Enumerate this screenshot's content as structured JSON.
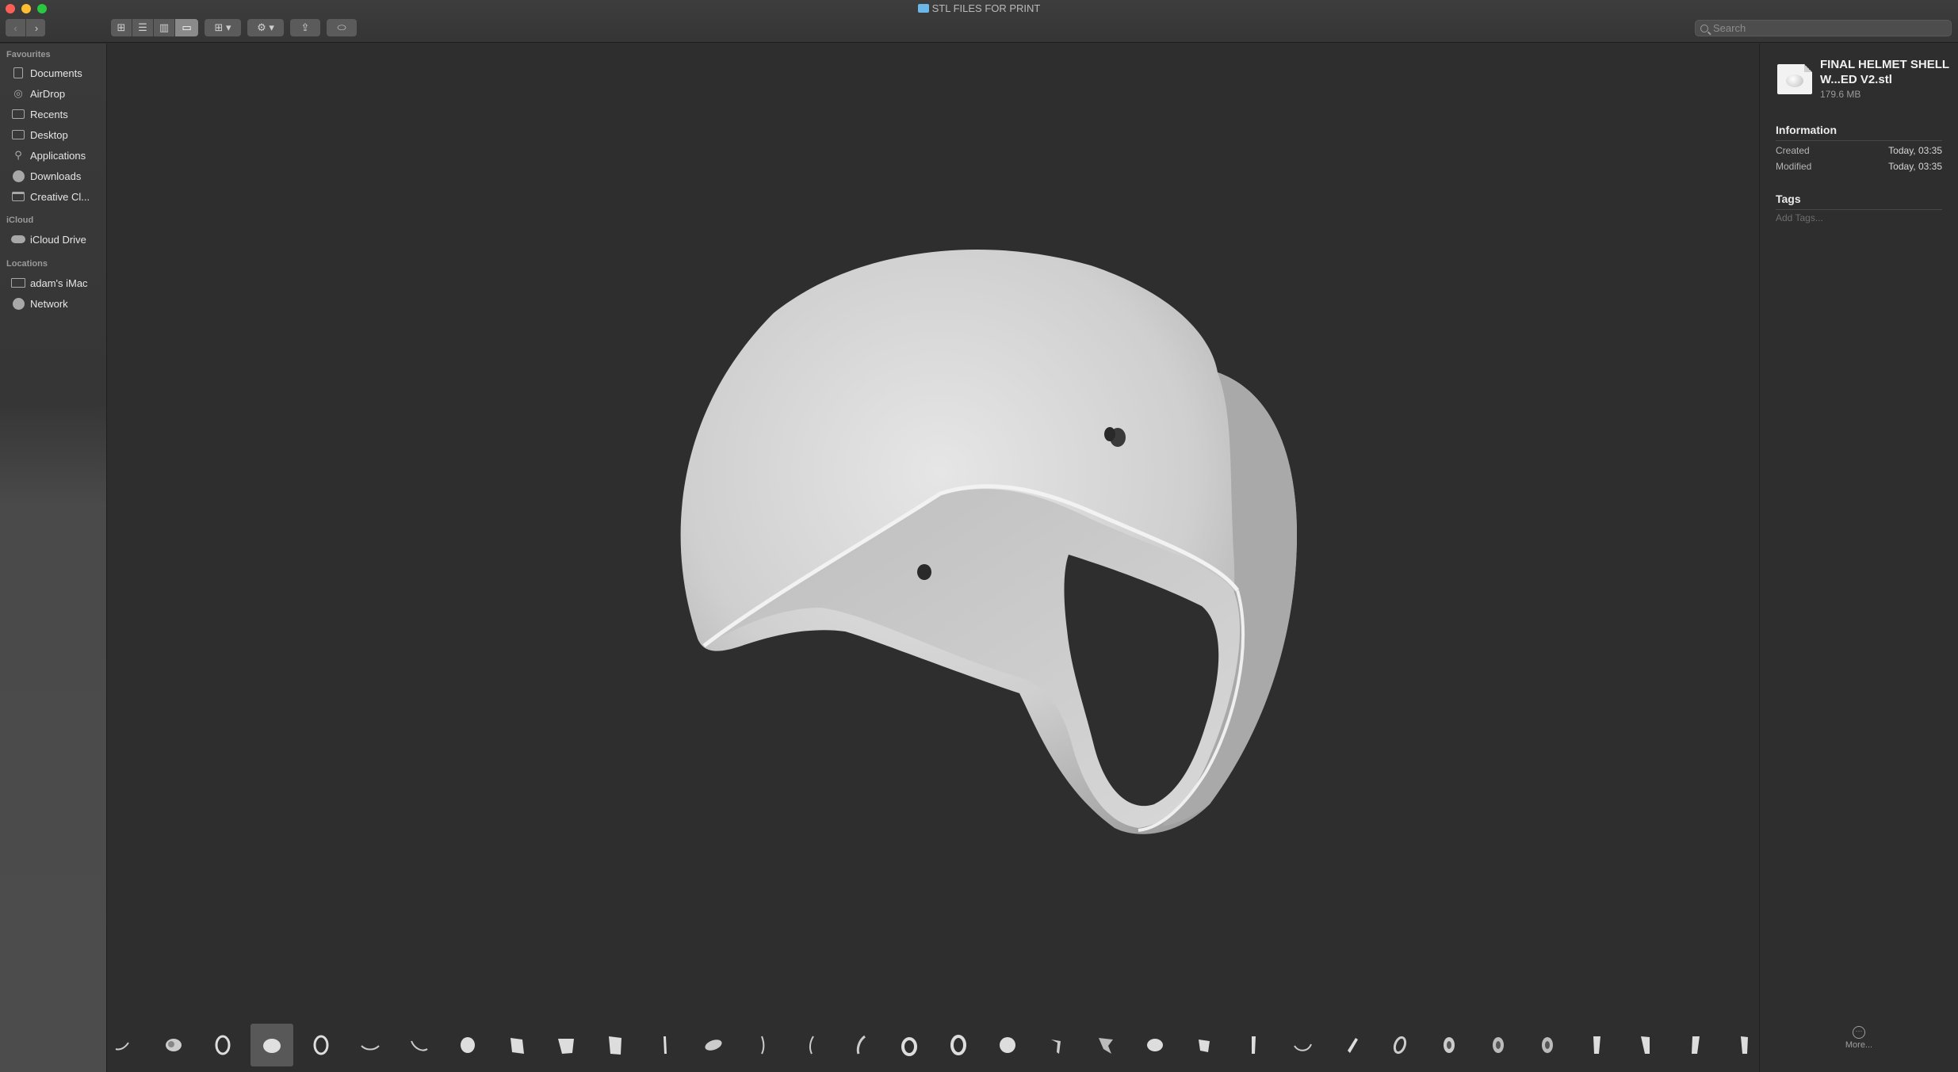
{
  "window": {
    "title": "STL FILES FOR PRINT"
  },
  "toolbar": {
    "back": "‹",
    "forward": "›",
    "view_icons": "⊞",
    "view_list": "☰",
    "view_columns": "▥",
    "view_gallery": "▭",
    "group_by": "⊞ ▾",
    "action": "⚙ ▾",
    "share": "⇪",
    "tag": "⬭"
  },
  "search": {
    "placeholder": "Search"
  },
  "sidebar": {
    "favourites_heading": "Favourites",
    "favourites": [
      {
        "label": "Documents",
        "icon": "document-icon"
      },
      {
        "label": "AirDrop",
        "icon": "airdrop-icon"
      },
      {
        "label": "Recents",
        "icon": "recents-icon"
      },
      {
        "label": "Desktop",
        "icon": "desktop-icon"
      },
      {
        "label": "Applications",
        "icon": "applications-icon"
      },
      {
        "label": "Downloads",
        "icon": "downloads-icon"
      },
      {
        "label": "Creative Cl...",
        "icon": "folder-icon"
      }
    ],
    "icloud_heading": "iCloud",
    "icloud": [
      {
        "label": "iCloud Drive",
        "icon": "cloud-icon"
      }
    ],
    "locations_heading": "Locations",
    "locations": [
      {
        "label": "adam's iMac",
        "icon": "computer-icon"
      },
      {
        "label": "Network",
        "icon": "globe-icon"
      }
    ]
  },
  "inspector": {
    "file_name": "FINAL HELMET SHELL W...ED V2.stl",
    "file_size": "179.6 MB",
    "information_heading": "Information",
    "created_label": "Created",
    "created_value": "Today, 03:35",
    "modified_label": "Modified",
    "modified_value": "Today, 03:35",
    "tags_heading": "Tags",
    "add_tags_placeholder": "Add Tags...",
    "more_label": "More..."
  },
  "filmstrip": {
    "selected_index": 3,
    "count": 34
  },
  "colors": {
    "background": "#2e2e2e",
    "sidebar": "#3a3a3a",
    "accent_red": "#fd5f57",
    "accent_yellow": "#febc2e",
    "accent_green": "#28c840"
  }
}
